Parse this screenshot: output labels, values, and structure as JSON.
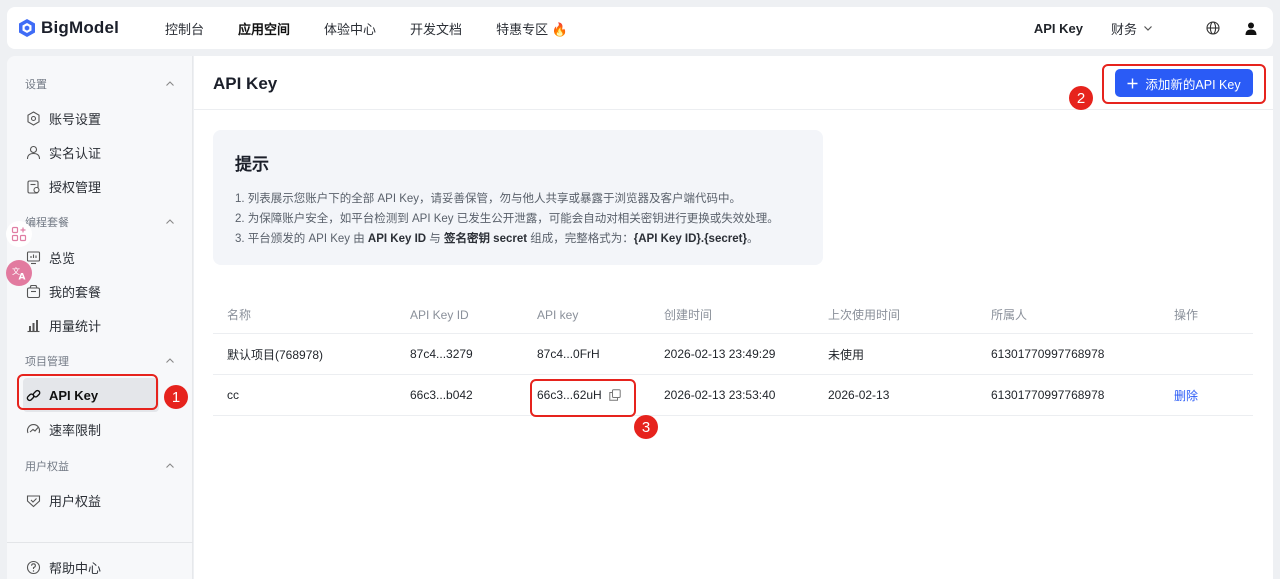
{
  "brand": {
    "name": "BigModel"
  },
  "topnav": {
    "items": [
      {
        "label": "控制台",
        "active": false
      },
      {
        "label": "应用空间",
        "active": true
      },
      {
        "label": "体验中心",
        "active": false
      },
      {
        "label": "开发文档",
        "active": false
      },
      {
        "label": "特惠专区",
        "active": false,
        "emoji": "🔥"
      }
    ],
    "api_key": "API Key",
    "finance": "财务",
    "icons": [
      "globe-icon",
      "user-icon",
      "chevron-down-icon"
    ]
  },
  "sidebar": {
    "sections": [
      {
        "title": "设置",
        "items": [
          {
            "label": "账号设置",
            "icon": "gear-icon"
          },
          {
            "label": "实名认证",
            "icon": "person-icon"
          },
          {
            "label": "授权管理",
            "icon": "authorize-icon"
          }
        ]
      },
      {
        "title": "编程套餐",
        "items": [
          {
            "label": "总览",
            "icon": "overview-icon"
          },
          {
            "label": "我的套餐",
            "icon": "package-icon"
          },
          {
            "label": "用量统计",
            "icon": "bar-chart-icon"
          }
        ]
      },
      {
        "title": "项目管理",
        "items": [
          {
            "label": "API Key",
            "icon": "link-icon",
            "active": true
          },
          {
            "label": "速率限制",
            "icon": "speed-icon"
          }
        ]
      },
      {
        "title": "用户权益",
        "items": [
          {
            "label": "用户权益",
            "icon": "benefit-icon"
          }
        ]
      }
    ],
    "footer": {
      "label": "帮助中心",
      "icon": "help-icon"
    }
  },
  "main": {
    "title": "API Key",
    "add_button": "添加新的API Key",
    "tip": {
      "title": "提示",
      "line1": "1. 列表展示您账户下的全部 API Key，请妥善保管，勿与他人共享或暴露于浏览器及客户端代码中。",
      "line2": "2. 为保障账户安全，如平台检测到 API Key 已发生公开泄露，可能会自动对相关密钥进行更换或失效处理。",
      "line3_a": "3. 平台颁发的 API Key 由 ",
      "line3_b": "API Key ID",
      "line3_c": " 与 ",
      "line3_d": "签名密钥 secret",
      "line3_e": " 组成，完整格式为：",
      "line3_f": "{API Key ID}.{secret}",
      "line3_g": "。"
    },
    "table": {
      "headers": [
        "名称",
        "API Key ID",
        "API key",
        "创建时间",
        "上次使用时间",
        "所属人",
        "操作"
      ],
      "rows": [
        {
          "name": "默认项目(768978)",
          "key_id": "87c4...3279",
          "api_key": "87c4...0FrH",
          "created": "2026-02-13 23:49:29",
          "last_used": "未使用",
          "owner": "61301770997768978",
          "action": ""
        },
        {
          "name": "cc",
          "key_id": "66c3...b042",
          "api_key": "66c3...62uH",
          "created": "2026-02-13 23:53:40",
          "last_used": "2026-02-13",
          "owner": "61301770997768978",
          "action": "删除"
        }
      ]
    }
  },
  "annotations": [
    "1",
    "2",
    "3"
  ],
  "colors": {
    "accent": "#2a5bf6",
    "annotation_red": "#e6231d"
  }
}
